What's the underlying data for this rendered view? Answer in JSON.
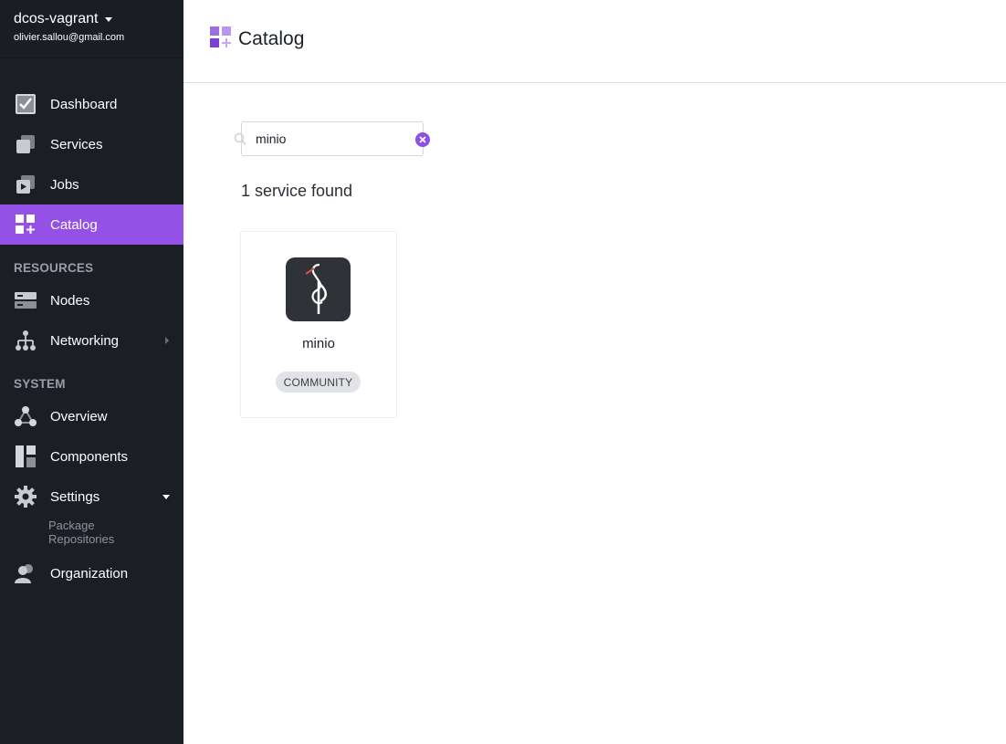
{
  "sidebar": {
    "cluster_name": "dcos-vagrant",
    "user_email": "olivier.sallou@gmail.com",
    "items": [
      {
        "label": "Dashboard",
        "icon": "dashboard-icon"
      },
      {
        "label": "Services",
        "icon": "services-icon"
      },
      {
        "label": "Jobs",
        "icon": "jobs-icon"
      },
      {
        "label": "Catalog",
        "icon": "catalog-icon",
        "active": true
      }
    ],
    "resources_heading": "RESOURCES",
    "resources": [
      {
        "label": "Nodes",
        "icon": "nodes-icon"
      },
      {
        "label": "Networking",
        "icon": "networking-icon"
      }
    ],
    "system_heading": "SYSTEM",
    "system": [
      {
        "label": "Overview",
        "icon": "overview-icon"
      },
      {
        "label": "Components",
        "icon": "components-icon"
      },
      {
        "label": "Settings",
        "icon": "gear-icon"
      }
    ],
    "settings_sub": "Package Repositories",
    "organization": {
      "label": "Organization",
      "icon": "organization-icon"
    }
  },
  "header": {
    "title": "Catalog",
    "icon": "catalog-icon"
  },
  "search": {
    "value": "minio",
    "placeholder": ""
  },
  "results": {
    "count_text": "1 service found"
  },
  "packages": [
    {
      "name": "minio",
      "badge": "COMMUNITY",
      "icon": "minio-logo"
    }
  ],
  "colors": {
    "accent": "#9351e5",
    "sidebar_bg": "#1c1e26",
    "badge_bg": "#e2e3e6"
  }
}
